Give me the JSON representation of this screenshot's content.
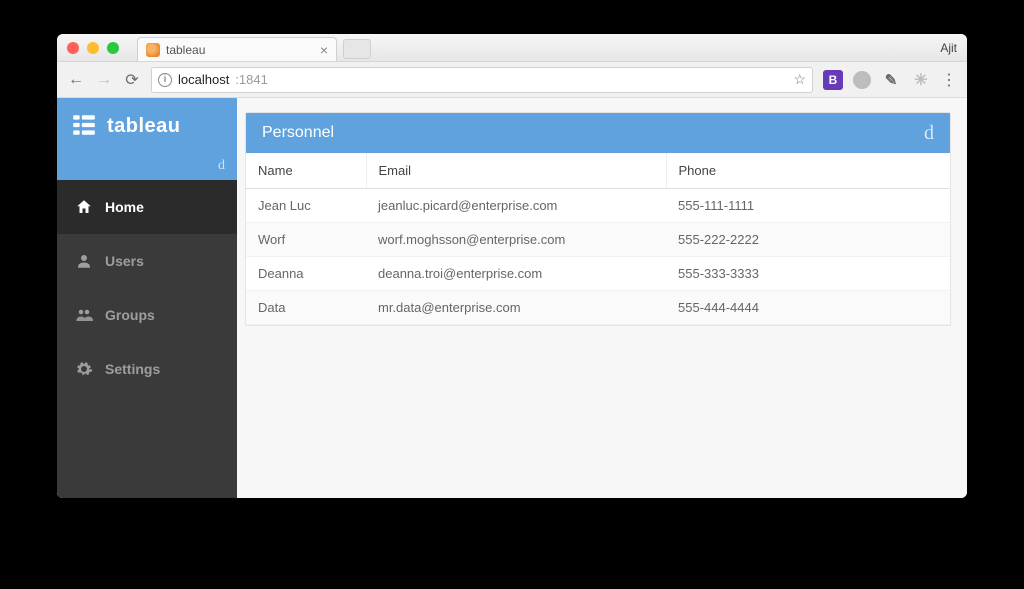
{
  "browser": {
    "profile": "Ajit",
    "tab_title": "tableau",
    "url_host": "localhost",
    "url_port": ":1841"
  },
  "sidebar": {
    "brand": "tableau",
    "brand_sub": "d",
    "items": [
      {
        "label": "Home"
      },
      {
        "label": "Users"
      },
      {
        "label": "Groups"
      },
      {
        "label": "Settings"
      }
    ]
  },
  "panel": {
    "title": "Personnel",
    "badge": "d",
    "columns": [
      "Name",
      "Email",
      "Phone"
    ],
    "rows": [
      {
        "name": "Jean Luc",
        "email": "jeanluc.picard@enterprise.com",
        "phone": "555-111-1111"
      },
      {
        "name": "Worf",
        "email": "worf.moghsson@enterprise.com",
        "phone": "555-222-2222"
      },
      {
        "name": "Deanna",
        "email": "deanna.troi@enterprise.com",
        "phone": "555-333-3333"
      },
      {
        "name": "Data",
        "email": "mr.data@enterprise.com",
        "phone": "555-444-4444"
      }
    ]
  }
}
